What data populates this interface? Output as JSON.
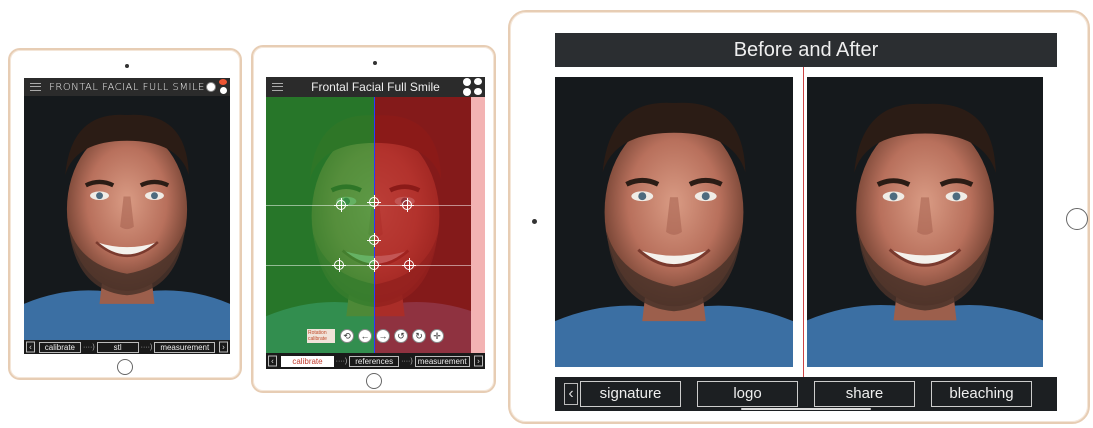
{
  "tablet1": {
    "title": "FRONTAL FACIAL FULL SMILE",
    "buttons": {
      "calibrate": "calibrate",
      "stl": "stl",
      "measurement": "measurement"
    },
    "dots": "····)",
    "icons": [
      "menu-icon",
      "settings-icon",
      "toggle-icon",
      "help-icon"
    ]
  },
  "tablet2": {
    "title": "Frontal Facial Full Smile",
    "buttons": {
      "calibrate": "calibrate",
      "references": "references",
      "measurement": "measurement"
    },
    "dots": "····)",
    "overlay_colors": {
      "left": "#2f9a2f",
      "right": "#b01a1a"
    },
    "tools_caption": "Rotation calibrate",
    "tool_icons": [
      "rotate-icon",
      "arrow-left-icon",
      "arrow-right-icon",
      "rotate-ccw-icon",
      "rotate-cw-icon",
      "crosshair-icon"
    ]
  },
  "tablet3": {
    "title": "Before and After",
    "buttons": {
      "signature": "signature",
      "logo": "logo",
      "share": "share",
      "bleaching": "bleaching"
    }
  },
  "chev_left": "‹",
  "chev_right": "›"
}
